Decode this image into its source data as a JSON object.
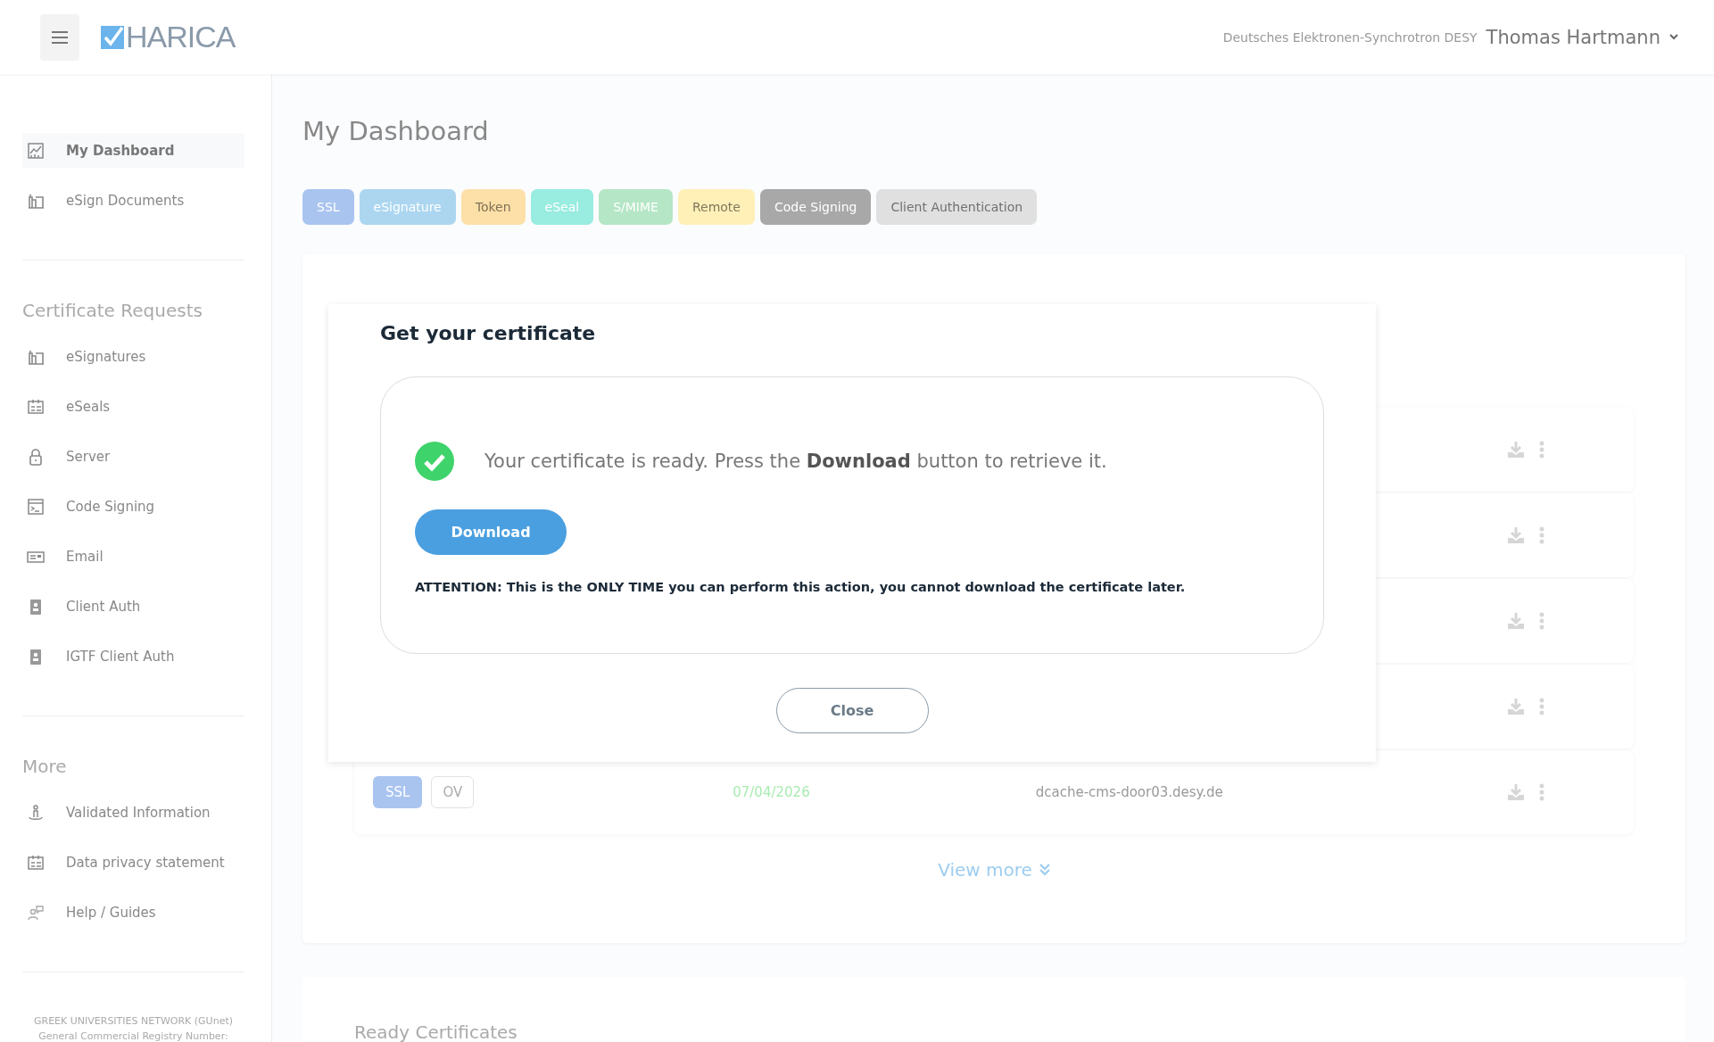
{
  "header": {
    "logo": "HARICA",
    "organization": "Deutsches Elektronen-Synchrotron DESY",
    "user": "Thomas Hartmann"
  },
  "sidebar": {
    "sections": [
      {
        "items": [
          {
            "label": "My Dashboard",
            "selected": true
          },
          {
            "label": "eSign Documents",
            "selected": false
          }
        ]
      },
      {
        "title": "Certificate Requests",
        "items": [
          {
            "label": "eSignatures",
            "selected": false
          },
          {
            "label": "eSeals",
            "selected": false
          },
          {
            "label": "Server",
            "selected": false
          },
          {
            "label": "Code Signing",
            "selected": false
          },
          {
            "label": "Email",
            "selected": false
          },
          {
            "label": "Client Auth",
            "selected": false
          },
          {
            "label": "IGTF Client Auth",
            "selected": false
          }
        ]
      },
      {
        "title": "More",
        "items": [
          {
            "label": "Validated Information",
            "selected": false
          },
          {
            "label": "Data privacy statement",
            "selected": false
          },
          {
            "label": "Help / Guides",
            "selected": false
          }
        ]
      }
    ],
    "footer": [
      "GREEK UNIVERSITIES NETWORK (GUnet)",
      "General Commercial Registry Number:"
    ]
  },
  "page_title": "My Dashboard",
  "filters": [
    {
      "label": "SSL",
      "color": "#aac4f0"
    },
    {
      "label": "eSignature",
      "color": "#acd6f0"
    },
    {
      "label": "Token",
      "color": "#fde0a8"
    },
    {
      "label": "eSeal",
      "color": "#98ece0"
    },
    {
      "label": "S/MIME",
      "color": "#b5e6c6"
    },
    {
      "label": "Remote",
      "color": "#fff0b8"
    },
    {
      "label": "Code Signing",
      "color": "#a8a8a8"
    },
    {
      "label": "Client Authentication",
      "color": "#e0e0e0"
    }
  ],
  "certificates": {
    "rows": [
      {},
      {},
      {},
      {},
      {
        "type": "SSL",
        "validation": "OV",
        "expires": "07/04/2026",
        "domain": "dcache-cms-door03.desy.de"
      }
    ],
    "view_more": "View more"
  },
  "ready_certificates": {
    "title": "Ready Certificates"
  },
  "dialog": {
    "title": "Get your certificate",
    "message": "Your certificate is ready. Press the **Download** button to retrieve it.",
    "download": "Download",
    "attention": "ATTENTION: This is the ONLY TIME you can perform this action, you cannot download the certificate later.",
    "close": "Close"
  }
}
